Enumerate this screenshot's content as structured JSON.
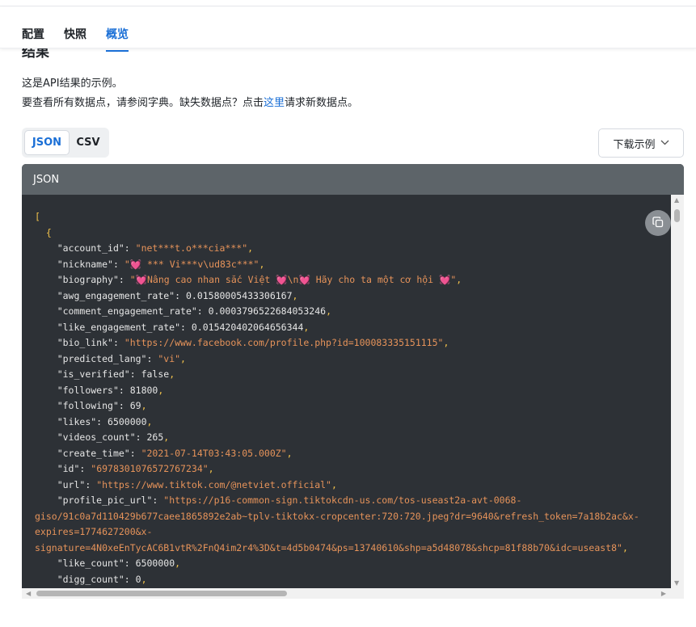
{
  "tabs": [
    {
      "label": "配置",
      "active": false
    },
    {
      "label": "快照",
      "active": false
    },
    {
      "label": "概览",
      "active": true
    }
  ],
  "section": {
    "title": "结果",
    "line1": "这是API结果的示例。",
    "line2_before": "要查看所有数据点，请参阅字典。缺失数据点？点击",
    "line2_link": "这里",
    "line2_after": "请求新数据点。"
  },
  "format_buttons": [
    {
      "label": "JSON",
      "active": true
    },
    {
      "label": "CSV",
      "active": false
    }
  ],
  "download_button": {
    "label": "下载示例",
    "icon": "chevron-down-icon"
  },
  "code_panel": {
    "header": "JSON",
    "copy_icon": "copy-icon",
    "lines": [
      {
        "indent": "",
        "text": "["
      },
      {
        "indent": "  ",
        "text": "{"
      },
      {
        "indent": "    ",
        "key": "\"account_id\"",
        "value": "\"net***t.o***cia***\"",
        "vtype": "s",
        "comma": true
      },
      {
        "indent": "    ",
        "key": "\"nickname\"",
        "value": "\"💓 *** Vi***v\\ud83c***\"",
        "vtype": "s",
        "comma": true
      },
      {
        "indent": "    ",
        "key": "\"biography\"",
        "value": "\"💓Nâng cao nhan sắc Việt 💓\\n💓 Hãy cho ta một cơ hội 💓\"",
        "vtype": "s",
        "comma": true
      },
      {
        "indent": "    ",
        "key": "\"awg_engagement_rate\"",
        "value": "0.01580005433306167",
        "vtype": "n",
        "comma": true
      },
      {
        "indent": "    ",
        "key": "\"comment_engagement_rate\"",
        "value": "0.0003796522684053246",
        "vtype": "n",
        "comma": true
      },
      {
        "indent": "    ",
        "key": "\"like_engagement_rate\"",
        "value": "0.015420402064656344",
        "vtype": "n",
        "comma": true
      },
      {
        "indent": "    ",
        "key": "\"bio_link\"",
        "value": "\"https://www.facebook.com/profile.php?id=100083335151115\"",
        "vtype": "s",
        "comma": true
      },
      {
        "indent": "    ",
        "key": "\"predicted_lang\"",
        "value": "\"vi\"",
        "vtype": "s",
        "comma": true
      },
      {
        "indent": "    ",
        "key": "\"is_verified\"",
        "value": "false",
        "vtype": "n",
        "comma": true
      },
      {
        "indent": "    ",
        "key": "\"followers\"",
        "value": "81800",
        "vtype": "n",
        "comma": true
      },
      {
        "indent": "    ",
        "key": "\"following\"",
        "value": "69",
        "vtype": "n",
        "comma": true
      },
      {
        "indent": "    ",
        "key": "\"likes\"",
        "value": "6500000",
        "vtype": "n",
        "comma": true
      },
      {
        "indent": "    ",
        "key": "\"videos_count\"",
        "value": "265",
        "vtype": "n",
        "comma": true
      },
      {
        "indent": "    ",
        "key": "\"create_time\"",
        "value": "\"2021-07-14T03:43:05.000Z\"",
        "vtype": "s",
        "comma": true
      },
      {
        "indent": "    ",
        "key": "\"id\"",
        "value": "\"6978301076572767234\"",
        "vtype": "s",
        "comma": true
      },
      {
        "indent": "    ",
        "key": "\"url\"",
        "value": "\"https://www.tiktok.com/@netviet.official\"",
        "vtype": "s",
        "comma": true
      },
      {
        "indent": "    ",
        "key": "\"profile_pic_url\"",
        "value": "\"https://p16-common-sign.tiktokcdn-us.com/tos-useast2a-avt-0068-",
        "vtype": "s",
        "comma": false
      },
      {
        "indent": "",
        "value": "giso/91c0a7d110429b677caee1865892e2ab~tplv-tiktokx-cropcenter:720:720.jpeg?dr=9640&refresh_token=7a18b2ac&x-",
        "vtype": "s",
        "comma": false
      },
      {
        "indent": "",
        "value": "expires=1774627200&x-",
        "vtype": "s",
        "comma": false
      },
      {
        "indent": "",
        "value": "signature=4N0xeEnTycAC6B1vtR%2FnQ4im2r4%3D&t=4d5b0474&ps=13740610&shp=a5d48078&shcp=81f88b70&idc=useast8\"",
        "vtype": "s",
        "comma": true
      },
      {
        "indent": "    ",
        "key": "\"like_count\"",
        "value": "6500000",
        "vtype": "n",
        "comma": true
      },
      {
        "indent": "    ",
        "key": "\"digg_count\"",
        "value": "0",
        "vtype": "n",
        "comma": true
      }
    ]
  }
}
